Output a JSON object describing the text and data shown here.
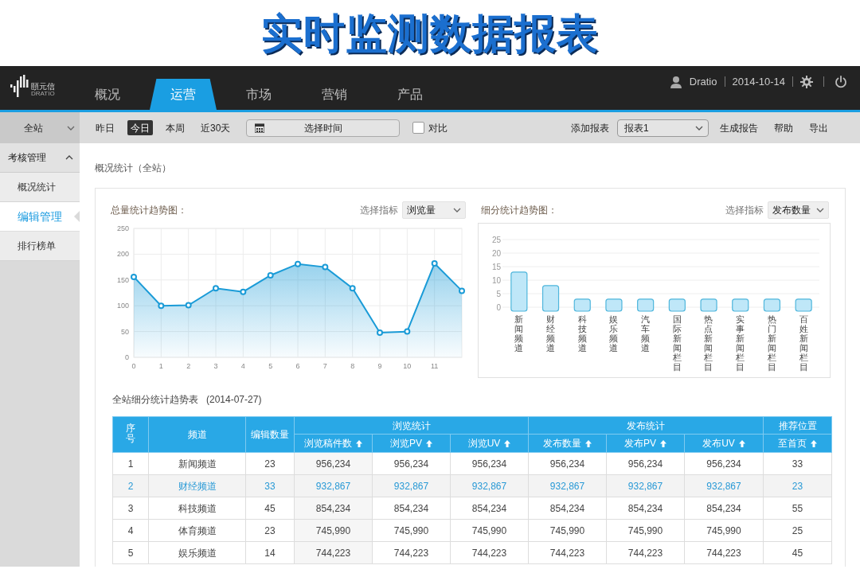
{
  "title": "实时监测数据报表",
  "topbar": {
    "logo_text": "頤元信",
    "logo_subtext": "DRATIO",
    "tabs": [
      {
        "label": "概况",
        "selected": false
      },
      {
        "label": "运营",
        "selected": true
      },
      {
        "label": "市场",
        "selected": false
      },
      {
        "label": "营销",
        "selected": false
      },
      {
        "label": "产品",
        "selected": false
      }
    ],
    "user": "Dratio",
    "date": "2014-10-14"
  },
  "toolbar": {
    "site_select": "全站",
    "ranges": [
      {
        "label": "昨日",
        "selected": false
      },
      {
        "label": "今日",
        "selected": true
      },
      {
        "label": "本周",
        "selected": false
      },
      {
        "label": "近30天",
        "selected": false
      }
    ],
    "date_picker": "选择时间",
    "compare": {
      "label": "对比",
      "checked": false
    },
    "add_report_label": "添加报表",
    "report_select": "报表1",
    "actions": [
      "生成报告",
      "帮助",
      "导出"
    ]
  },
  "sidebar": {
    "section": {
      "label": "考核管理",
      "expanded": true
    },
    "items": [
      {
        "label": "概况统计",
        "selected": false
      },
      {
        "label": "编辑管理",
        "selected": true
      },
      {
        "label": "排行榜单",
        "selected": false
      }
    ]
  },
  "breadcrumb": "概况统计（全站）",
  "line_panel": {
    "title": "总量统计趋势图：",
    "metric_label": "选择指标",
    "metric": "浏览量",
    "chart_data": {
      "type": "area",
      "x": [
        0,
        1,
        2,
        3,
        4,
        5,
        6,
        7,
        8,
        9,
        10,
        11,
        12
      ],
      "series": [
        {
          "color": "#1a9bd7",
          "values": [
            156,
            100,
            101,
            134,
            127,
            159,
            181,
            175,
            134,
            48,
            50,
            182,
            129
          ]
        }
      ],
      "xticks": [
        0,
        1,
        2,
        3,
        4,
        5,
        6,
        7,
        8,
        9,
        10,
        11
      ],
      "xlim": [
        0,
        12
      ],
      "yticks": [
        0,
        50,
        100,
        150,
        200,
        250
      ],
      "ylim": [
        0,
        250
      ],
      "grid": true
    }
  },
  "bar_panel": {
    "title": "细分统计趋势图：",
    "metric_label": "选择指标",
    "metric": "发布数量",
    "chart_data": {
      "type": "bar",
      "categories": [
        "新闻频道",
        "财经频道",
        "科技频道",
        "娱乐频道",
        "汽车频道",
        "国际新闻栏目",
        "热点新闻栏目",
        "实事新闻栏目",
        "热门新闻栏目",
        "百姓新闻栏目"
      ],
      "series": [
        {
          "color": "#bfe7f8",
          "values": [
            13,
            8,
            3,
            3,
            3,
            3,
            3,
            3,
            3,
            3
          ]
        }
      ],
      "yticks": [
        0,
        5,
        10,
        15,
        20,
        25
      ],
      "ylim": [
        0,
        25
      ],
      "grid": true
    }
  },
  "table": {
    "title": "全站细分统计趋势表",
    "date": "(2014-07-27)",
    "columns": [
      "序号",
      "频道",
      "编辑数量"
    ],
    "groups": [
      {
        "label": "浏览统计",
        "columns": [
          "浏览稿件数",
          "浏览PV",
          "浏览UV"
        ]
      },
      {
        "label": "发布统计",
        "columns": [
          "发布数量",
          "发布PV",
          "发布UV"
        ]
      },
      {
        "label": "推荐位置",
        "columns": [
          "至首页"
        ]
      }
    ],
    "rows": [
      {
        "selected": false,
        "cells": [
          "1",
          "新闻频道",
          "23",
          "956,234",
          "956,234",
          "956,234",
          "956,234",
          "956,234",
          "956,234",
          "33"
        ]
      },
      {
        "selected": true,
        "cells": [
          "2",
          "财经频道",
          "33",
          "932,867",
          "932,867",
          "932,867",
          "932,867",
          "932,867",
          "932,867",
          "23"
        ]
      },
      {
        "selected": false,
        "cells": [
          "3",
          "科技频道",
          "45",
          "854,234",
          "854,234",
          "854,234",
          "854,234",
          "854,234",
          "854,234",
          "55"
        ]
      },
      {
        "selected": false,
        "cells": [
          "4",
          "体育频道",
          "23",
          "745,990",
          "745,990",
          "745,990",
          "745,990",
          "745,990",
          "745,990",
          "25"
        ]
      },
      {
        "selected": false,
        "cells": [
          "5",
          "娱乐频道",
          "14",
          "744,223",
          "744,223",
          "744,223",
          "744,223",
          "744,223",
          "744,223",
          "45"
        ]
      }
    ]
  }
}
